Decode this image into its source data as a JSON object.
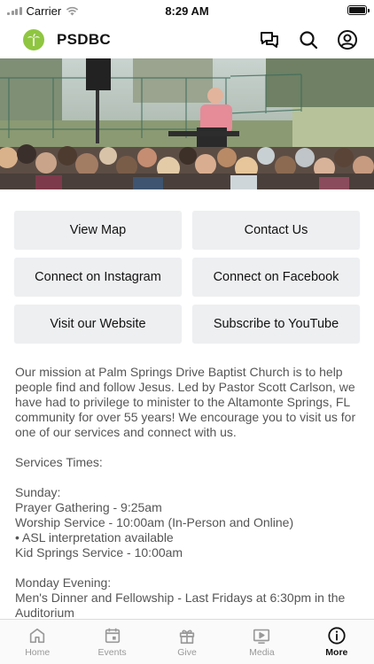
{
  "status_bar": {
    "carrier": "Carrier",
    "time": "8:29 AM"
  },
  "header": {
    "title": "PSDBC",
    "logo_color": "#8fc641"
  },
  "buttons": [
    {
      "label": "View Map",
      "name": "view-map-button"
    },
    {
      "label": "Contact Us",
      "name": "contact-us-button"
    },
    {
      "label": "Connect on Instagram",
      "name": "instagram-button"
    },
    {
      "label": "Connect on Facebook",
      "name": "facebook-button"
    },
    {
      "label": "Visit our Website",
      "name": "website-button"
    },
    {
      "label": "Subscribe to YouTube",
      "name": "youtube-button"
    }
  ],
  "description": {
    "mission": "Our mission at Palm Springs Drive Baptist Church is to help people find and follow Jesus. Led by Pastor Scott Carlson, we have had to privilege to minister to the Altamonte Springs, FL community for over 55 years! We encourage you to visit us for one of our services and connect with us.",
    "services_heading": "Services Times:",
    "sunday_heading": "Sunday:",
    "sunday_items": [
      "Prayer Gathering - 9:25am",
      "Worship Service - 10:00am  (In-Person and Online)",
      "• ASL interpretation available",
      "Kid Springs Service - 10:00am"
    ],
    "monday_heading": "Monday Evening:",
    "monday_items": [
      "Men's Dinner and Fellowship - Last Fridays at 6:30pm in the Auditorium"
    ]
  },
  "tab_bar": {
    "tabs": [
      {
        "label": "Home",
        "icon": "home-icon",
        "active": false
      },
      {
        "label": "Events",
        "icon": "calendar-icon",
        "active": false
      },
      {
        "label": "Give",
        "icon": "gift-icon",
        "active": false
      },
      {
        "label": "Media",
        "icon": "play-video-icon",
        "active": false
      },
      {
        "label": "More",
        "icon": "info-icon",
        "active": true
      }
    ]
  }
}
